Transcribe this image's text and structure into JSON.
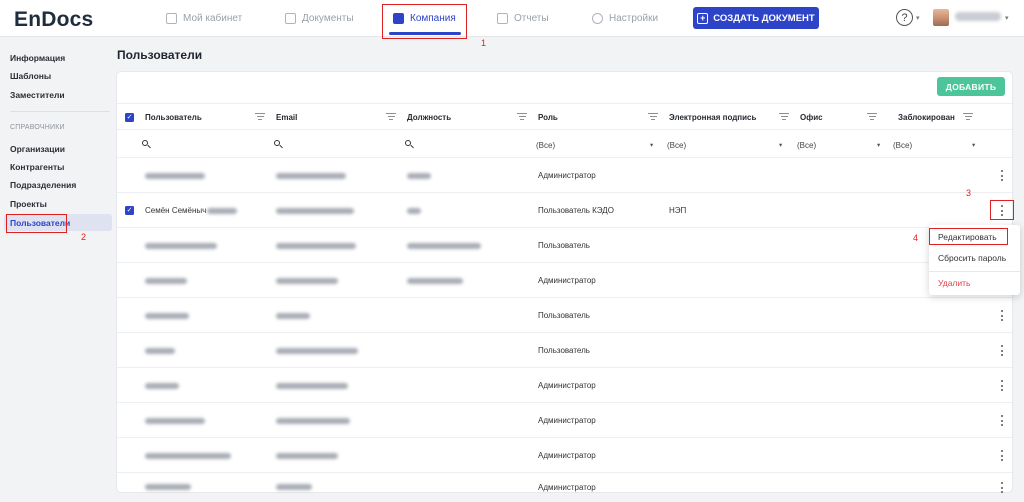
{
  "app": {
    "logo": "EnDocs"
  },
  "nav": {
    "items": [
      {
        "label": "Мой кабинет",
        "icon": "grid-icon"
      },
      {
        "label": "Документы",
        "icon": "document-icon"
      },
      {
        "label": "Компания",
        "icon": "building-icon",
        "active": true
      },
      {
        "label": "Отчеты",
        "icon": "chart-icon"
      },
      {
        "label": "Настройки",
        "icon": "gear-icon"
      }
    ],
    "create_button": "СОЗДАТЬ ДОКУМЕНТ",
    "help": "?",
    "caret": "▾"
  },
  "sidebar": {
    "top_items": [
      "Информация",
      "Шаблоны",
      "Заместители"
    ],
    "section_title": "СПРАВОЧНИКИ",
    "section_items": [
      "Организации",
      "Контрагенты",
      "Подразделения",
      "Проекты",
      "Пользователи"
    ],
    "active_item": "Пользователи"
  },
  "main": {
    "title": "Пользователи",
    "add_button": "ДОБАВИТЬ",
    "columns": [
      "Пользователь",
      "Email",
      "Должность",
      "Роль",
      "Электронная подпись",
      "Офис",
      "Заблокирован"
    ],
    "filters": {
      "role": "(Все)",
      "signature": "(Все)",
      "office": "(Все)",
      "blocked": "(Все)"
    },
    "rows": [
      {
        "role": "Администратор",
        "signature": "",
        "selected": false,
        "blur_widths": [
          60,
          70,
          24
        ]
      },
      {
        "user": "Семён Семёныч",
        "role": "Пользователь КЭДО",
        "signature": "НЭП",
        "selected": true,
        "blur_widths": [
          30,
          78,
          14
        ]
      },
      {
        "role": "Пользователь",
        "signature": "",
        "selected": false,
        "blur_widths": [
          72,
          80,
          74
        ]
      },
      {
        "role": "Администратор",
        "signature": "",
        "selected": false,
        "blur_widths": [
          42,
          62,
          56
        ]
      },
      {
        "role": "Пользователь",
        "signature": "",
        "selected": false,
        "blur_widths": [
          44,
          34,
          0
        ]
      },
      {
        "role": "Пользователь",
        "signature": "",
        "selected": false,
        "blur_widths": [
          30,
          82,
          0
        ]
      },
      {
        "role": "Администратор",
        "signature": "",
        "selected": false,
        "blur_widths": [
          34,
          72,
          0
        ]
      },
      {
        "role": "Администратор",
        "signature": "",
        "selected": false,
        "blur_widths": [
          60,
          74,
          0
        ]
      },
      {
        "role": "Администратор",
        "signature": "",
        "selected": false,
        "blur_widths": [
          86,
          62,
          0
        ]
      },
      {
        "role": "Администратор",
        "signature": "",
        "selected": false,
        "blur_widths": [
          46,
          36,
          0
        ]
      }
    ]
  },
  "context_menu": {
    "items": [
      "Редактировать",
      "Сбросить пароль"
    ],
    "danger_item": "Удалить"
  },
  "annotations": [
    "1",
    "2",
    "3",
    "4"
  ],
  "colors": {
    "accent": "#2d44c8",
    "add_button": "#4cc59a",
    "annotation": "#e02020",
    "danger": "#e0454a"
  }
}
